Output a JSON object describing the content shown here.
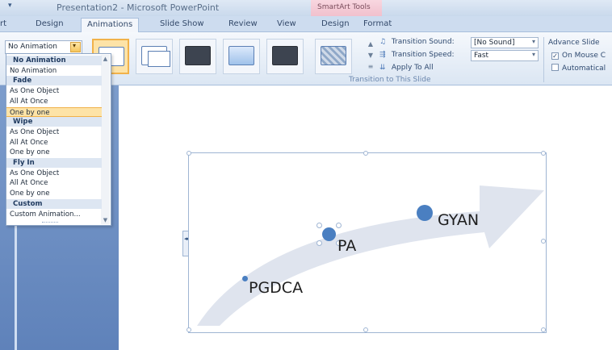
{
  "titlebar": {
    "qat_arrow": "▾",
    "title": "Presentation2 - Microsoft PowerPoint",
    "contextual_tab": "SmartArt Tools"
  },
  "tabs": [
    {
      "label": "rt"
    },
    {
      "label": "Design"
    },
    {
      "label": "Animations"
    },
    {
      "label": "Slide Show"
    },
    {
      "label": "Review"
    },
    {
      "label": "View"
    },
    {
      "label": "Design"
    },
    {
      "label": "Format"
    }
  ],
  "animate": {
    "selected": "No Animation"
  },
  "transition": {
    "sound_label": "Transition Sound:",
    "sound_value": "[No Sound]",
    "speed_label": "Transition Speed:",
    "speed_value": "Fast",
    "apply_all": "Apply To All",
    "group_label": "Transition to This Slide"
  },
  "advance": {
    "title": "Advance Slide",
    "on_mouse_click": "On Mouse C",
    "automatically": "Automatical"
  },
  "dropdown": {
    "items": [
      {
        "label": "No Animation",
        "kind": "header"
      },
      {
        "label": "No Animation",
        "kind": "item"
      },
      {
        "label": "Fade",
        "kind": "header"
      },
      {
        "label": "As One Object",
        "kind": "item"
      },
      {
        "label": "All At Once",
        "kind": "item"
      },
      {
        "label": "One by one",
        "kind": "selected"
      },
      {
        "label": "Wipe",
        "kind": "header"
      },
      {
        "label": "As One Object",
        "kind": "item"
      },
      {
        "label": "All At Once",
        "kind": "item"
      },
      {
        "label": "One by one",
        "kind": "item"
      },
      {
        "label": "Fly In",
        "kind": "header"
      },
      {
        "label": "As One Object",
        "kind": "item"
      },
      {
        "label": "All At Once",
        "kind": "item"
      },
      {
        "label": "One by one",
        "kind": "item"
      },
      {
        "label": "Custom",
        "kind": "header"
      },
      {
        "label": "Custom Animation...",
        "kind": "item"
      }
    ]
  },
  "smartart": {
    "labels": [
      "PGDCA",
      "PA",
      "GYAN"
    ]
  },
  "colors": {
    "accent_selected": "#fde3a7",
    "ribbon": "#dbe6f3",
    "arrow_fill": "#dfe4ee",
    "dot": "#4a7fc1"
  }
}
